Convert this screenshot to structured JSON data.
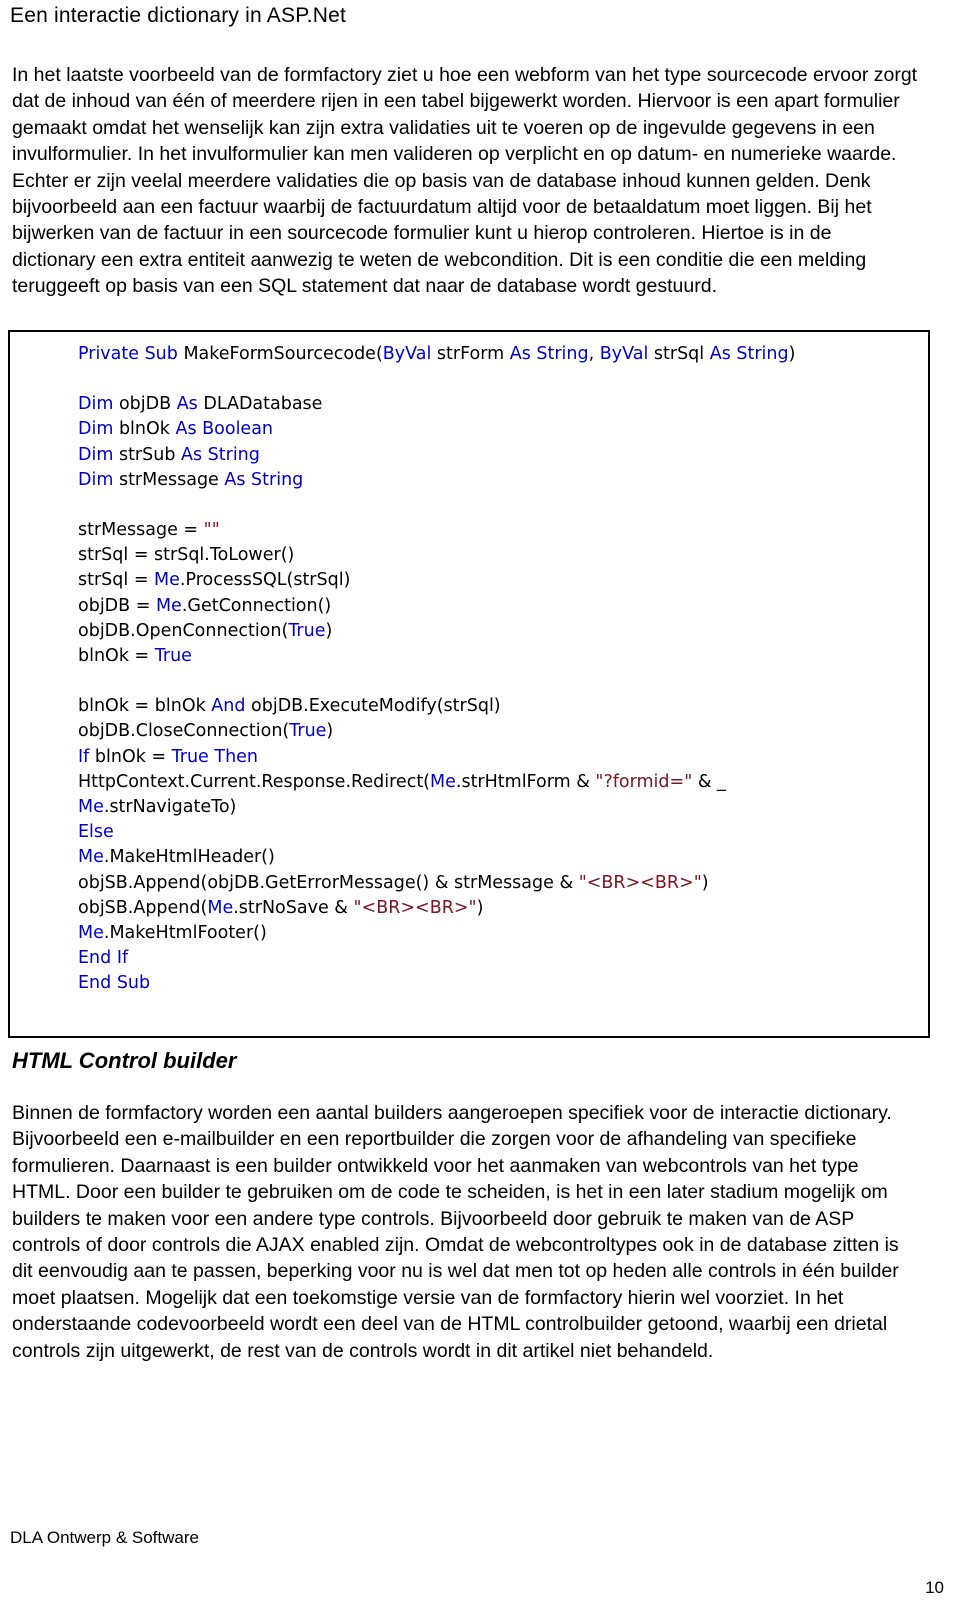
{
  "document": {
    "running_header": "Een interactie dictionary in ASP.Net",
    "footer_left": "DLA Ontwerp & Software",
    "page_number": "10"
  },
  "colors": {
    "keyword_blue": "#0000CC",
    "string_darkred": "#7A1520",
    "text_black": "#000000",
    "code_border": "#000000",
    "page_background": "#FFFFFF"
  },
  "body": {
    "intro_paragraph": "In het laatste voorbeeld van de formfactory ziet u hoe een webform van het type sourcecode ervoor zorgt dat de inhoud van één of meerdere rijen in een tabel bijgewerkt worden. Hiervoor is een apart formulier gemaakt omdat het wenselijk kan zijn extra validaties uit te voeren op de ingevulde gegevens in een invulformulier. In het invulformulier kan men valideren op verplicht en op datum- en numerieke waarde. Echter er zijn veelal meerdere validaties die op basis van de database inhoud kunnen gelden. Denk bijvoorbeeld aan een factuur waarbij de factuurdatum altijd voor de betaaldatum moet liggen. Bij het bijwerken van de factuur in een sourcecode formulier kunt u hierop controleren. Hiertoe is in de dictionary een extra entiteit aanwezig te weten de webcondition. Dit is een conditie die een melding teruggeeft op basis van een SQL statement dat naar de database wordt gestuurd.",
    "section_heading": "HTML Control builder",
    "outro_paragraph": "Binnen de formfactory worden een aantal builders aangeroepen specifiek voor de interactie dictionary. Bijvoorbeeld een e-mailbuilder en een reportbuilder die zorgen voor de afhandeling van specifieke formulieren. Daarnaast is een builder ontwikkeld voor het aanmaken van webcontrols van het type HTML. Door een builder te gebruiken om de code te scheiden, is het in een later stadium mogelijk om builders te maken voor een andere type controls. Bijvoorbeeld door gebruik te maken van de ASP controls of door controls die AJAX enabled zijn. Omdat de webcontroltypes ook in de database zitten is dit eenvoudig aan te passen, beperking voor nu is wel dat men tot op heden alle controls in één builder moet plaatsen. Mogelijk dat een toekomstige versie van de formfactory hierin wel voorziet. In het onderstaande codevoorbeeld wordt een deel van de HTML controlbuilder getoond, waarbij een drietal controls zijn uitgewerkt, de rest van de controls wordt in dit artikel niet behandeld."
  },
  "code_block": {
    "language": "VB.NET",
    "lines": [
      [
        {
          "t": "Private Sub ",
          "c": "kw"
        },
        {
          "t": "MakeFormSourcecode(",
          "c": "plain"
        },
        {
          "t": "ByVal ",
          "c": "kw"
        },
        {
          "t": "strForm ",
          "c": "plain"
        },
        {
          "t": "As String",
          "c": "kw"
        },
        {
          "t": ", ",
          "c": "plain"
        },
        {
          "t": "ByVal ",
          "c": "kw"
        },
        {
          "t": "strSql ",
          "c": "plain"
        },
        {
          "t": "As String",
          "c": "kw"
        },
        {
          "t": ")",
          "c": "plain"
        }
      ],
      [],
      [
        {
          "t": "Dim ",
          "c": "kw"
        },
        {
          "t": "objDB ",
          "c": "plain"
        },
        {
          "t": "As ",
          "c": "kw"
        },
        {
          "t": "DLADatabase",
          "c": "plain"
        }
      ],
      [
        {
          "t": "Dim ",
          "c": "kw"
        },
        {
          "t": "blnOk ",
          "c": "plain"
        },
        {
          "t": "As Boolean",
          "c": "kw"
        }
      ],
      [
        {
          "t": "Dim ",
          "c": "kw"
        },
        {
          "t": "strSub ",
          "c": "plain"
        },
        {
          "t": "As String",
          "c": "kw"
        }
      ],
      [
        {
          "t": "Dim ",
          "c": "kw"
        },
        {
          "t": "strMessage ",
          "c": "plain"
        },
        {
          "t": "As String",
          "c": "kw"
        }
      ],
      [],
      [
        {
          "t": "strMessage = ",
          "c": "plain"
        },
        {
          "t": "\"\"",
          "c": "str"
        }
      ],
      [
        {
          "t": "strSql = strSql.ToLower()",
          "c": "plain"
        }
      ],
      [
        {
          "t": "strSql = ",
          "c": "plain"
        },
        {
          "t": "Me",
          "c": "kw"
        },
        {
          "t": ".ProcessSQL(strSql)",
          "c": "plain"
        }
      ],
      [
        {
          "t": "objDB = ",
          "c": "plain"
        },
        {
          "t": "Me",
          "c": "kw"
        },
        {
          "t": ".GetConnection()",
          "c": "plain"
        }
      ],
      [
        {
          "t": "objDB.OpenConnection(",
          "c": "plain"
        },
        {
          "t": "True",
          "c": "kw"
        },
        {
          "t": ")",
          "c": "plain"
        }
      ],
      [
        {
          "t": "blnOk = ",
          "c": "plain"
        },
        {
          "t": "True",
          "c": "kw"
        }
      ],
      [],
      [
        {
          "t": "blnOk = blnOk ",
          "c": "plain"
        },
        {
          "t": "And ",
          "c": "kw"
        },
        {
          "t": "objDB.ExecuteModify(strSql)",
          "c": "plain"
        }
      ],
      [
        {
          "t": "objDB.CloseConnection(",
          "c": "plain"
        },
        {
          "t": "True",
          "c": "kw"
        },
        {
          "t": ")",
          "c": "plain"
        }
      ],
      [
        {
          "t": "If ",
          "c": "kw"
        },
        {
          "t": "blnOk = ",
          "c": "plain"
        },
        {
          "t": "True Then",
          "c": "kw"
        }
      ],
      [
        {
          "t": "HttpContext.Current.Response.Redirect(",
          "c": "plain"
        },
        {
          "t": "Me",
          "c": "kw"
        },
        {
          "t": ".strHtmlForm & ",
          "c": "plain"
        },
        {
          "t": "\"?formid=\"",
          "c": "str"
        },
        {
          "t": " & _",
          "c": "plain"
        }
      ],
      [
        {
          "t": "Me",
          "c": "kw"
        },
        {
          "t": ".strNavigateTo)",
          "c": "plain"
        }
      ],
      [
        {
          "t": "Else",
          "c": "kw"
        }
      ],
      [
        {
          "t": "Me",
          "c": "kw"
        },
        {
          "t": ".MakeHtmlHeader()",
          "c": "plain"
        }
      ],
      [
        {
          "t": "objSB.Append(objDB.GetErrorMessage() & strMessage & ",
          "c": "plain"
        },
        {
          "t": "\"<BR><BR>\"",
          "c": "str"
        },
        {
          "t": ")",
          "c": "plain"
        }
      ],
      [
        {
          "t": "objSB.Append(",
          "c": "plain"
        },
        {
          "t": "Me",
          "c": "kw"
        },
        {
          "t": ".strNoSave & ",
          "c": "plain"
        },
        {
          "t": "\"<BR><BR>\"",
          "c": "str"
        },
        {
          "t": ")",
          "c": "plain"
        }
      ],
      [
        {
          "t": "Me",
          "c": "kw"
        },
        {
          "t": ".MakeHtmlFooter()",
          "c": "plain"
        }
      ],
      [
        {
          "t": "End If",
          "c": "kw"
        }
      ],
      [
        {
          "t": "End Sub",
          "c": "kw"
        }
      ]
    ]
  }
}
